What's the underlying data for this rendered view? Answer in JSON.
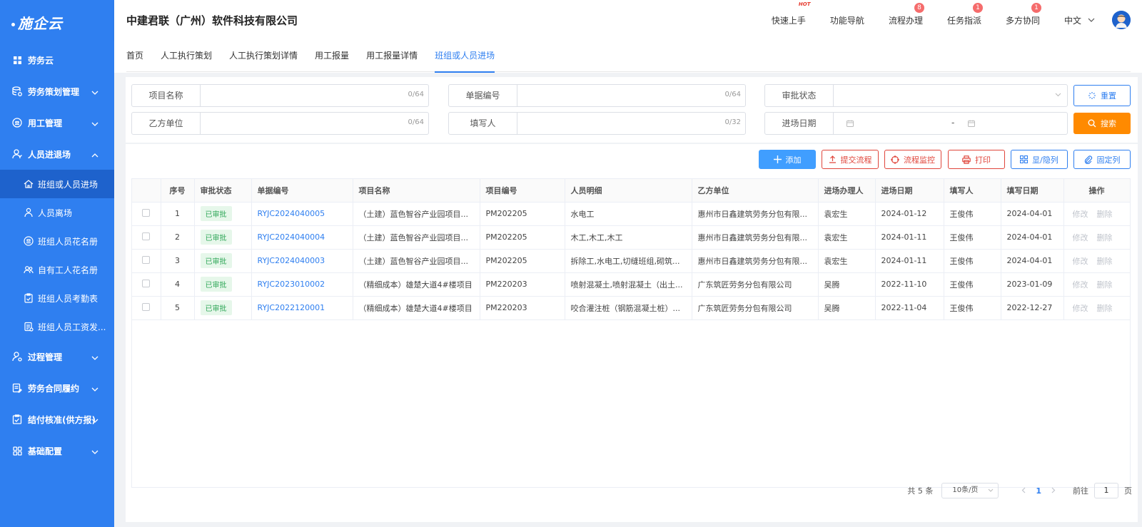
{
  "sidebar": {
    "logo": "施企云",
    "items": [
      {
        "label": "劳务云",
        "icon": "grid-icon",
        "expand": ""
      },
      {
        "label": "劳务策划管理",
        "icon": "database-icon",
        "expand": "down"
      },
      {
        "label": "用工管理",
        "icon": "worker-icon",
        "expand": "down"
      },
      {
        "label": "人员进退场",
        "icon": "user-icon",
        "expand": "up"
      }
    ],
    "subitems": [
      {
        "label": "班组或人员进场",
        "active": true
      },
      {
        "label": "人员离场",
        "active": false
      },
      {
        "label": "班组人员花名册",
        "active": false
      },
      {
        "label": "自有工人花名册",
        "active": false
      },
      {
        "label": "班组人员考勤表",
        "active": false
      },
      {
        "label": "班组人员工资发...",
        "active": false
      }
    ],
    "bottom_items": [
      {
        "label": "过程管理"
      },
      {
        "label": "劳务合同履约"
      },
      {
        "label": "结付核准(供方报)"
      },
      {
        "label": "基础配置"
      }
    ]
  },
  "header": {
    "company": "中建君联（广州）软件科技有限公司",
    "actions": [
      {
        "label": "快速上手",
        "badge": "",
        "hot": "HOT"
      },
      {
        "label": "功能导航",
        "badge": "",
        "hot": ""
      },
      {
        "label": "流程办理",
        "badge": "8",
        "hot": ""
      },
      {
        "label": "任务指派",
        "badge": "1",
        "hot": ""
      },
      {
        "label": "多方协同",
        "badge": "1",
        "hot": ""
      }
    ],
    "language": "中文"
  },
  "tabs": [
    "首页",
    "人工执行策划",
    "人工执行策划详情",
    "用工报量",
    "用工报量详情",
    "班组或人员进场"
  ],
  "active_tab": 5,
  "filters": {
    "project_name": {
      "label": "项目名称",
      "count": "0/64"
    },
    "doc_no": {
      "label": "单据编号",
      "count": "0/64"
    },
    "approval_status": {
      "label": "审批状态"
    },
    "party_b": {
      "label": "乙方单位",
      "count": "0/64"
    },
    "filler": {
      "label": "填写人",
      "count": "0/32"
    },
    "entry_date": {
      "label": "进场日期",
      "separator": "-"
    },
    "reset_label": "重置",
    "search_label": "搜索"
  },
  "toolbar": {
    "add": "添加",
    "submit_flow": "提交流程",
    "flow_monitor": "流程监控",
    "print": "打印",
    "show_hide": "显/隐列",
    "fix_col": "固定列"
  },
  "table": {
    "columns": [
      "序号",
      "审批状态",
      "单据编号",
      "项目名称",
      "项目编号",
      "人员明细",
      "乙方单位",
      "进场办理人",
      "进场日期",
      "填写人",
      "填写日期",
      "操作"
    ],
    "rows": [
      {
        "no": "1",
        "status": "已审批",
        "doc": "RYJC2024040005",
        "project": "（土建）蓝色智谷产业园项目...",
        "pcode": "PM202205",
        "detail": "水电工",
        "party": "惠州市日鑫建筑劳务分包有限...",
        "handler": "袁宏生",
        "entry": "2024-01-12",
        "filler": "王俊伟",
        "fill_date": "2024-04-01"
      },
      {
        "no": "2",
        "status": "已审批",
        "doc": "RYJC2024040004",
        "project": "（土建）蓝色智谷产业园项目...",
        "pcode": "PM202205",
        "detail": "木工,木工,木工",
        "party": "惠州市日鑫建筑劳务分包有限...",
        "handler": "袁宏生",
        "entry": "2024-01-11",
        "filler": "王俊伟",
        "fill_date": "2024-04-01"
      },
      {
        "no": "3",
        "status": "已审批",
        "doc": "RYJC2024040003",
        "project": "（土建）蓝色智谷产业园项目...",
        "pcode": "PM202205",
        "detail": "拆除工,水电工,切缝班组,砌筑...",
        "party": "惠州市日鑫建筑劳务分包有限...",
        "handler": "袁宏生",
        "entry": "2024-01-11",
        "filler": "王俊伟",
        "fill_date": "2024-04-01"
      },
      {
        "no": "4",
        "status": "已审批",
        "doc": "RYJC2023010002",
        "project": "（精细成本）雄楚大道4#楼项目",
        "pcode": "PM220203",
        "detail": "喷射混凝土,喷射混凝土（出土...",
        "party": "广东筑匠劳务分包有限公司",
        "handler": "吴腾",
        "entry": "2022-11-10",
        "filler": "王俊伟",
        "fill_date": "2023-01-09"
      },
      {
        "no": "5",
        "status": "已审批",
        "doc": "RYJC2022120001",
        "project": "（精细成本）雄楚大道4#楼项目",
        "pcode": "PM220203",
        "detail": "咬合灌注桩（钢筋混凝土桩）...",
        "party": "广东筑匠劳务分包有限公司",
        "handler": "吴腾",
        "entry": "2022-11-04",
        "filler": "王俊伟",
        "fill_date": "2022-12-27"
      }
    ],
    "op_edit": "修改",
    "op_delete": "删除"
  },
  "pager": {
    "total": "共 5 条",
    "page_size": "10条/页",
    "current": "1",
    "goto_label": "前往",
    "goto_value": "1",
    "page_unit": "页"
  },
  "colors": {
    "brand": "#2f7ff0",
    "search": "#ff8a00",
    "danger": "#e0453b",
    "status_green": "#31a85a"
  }
}
